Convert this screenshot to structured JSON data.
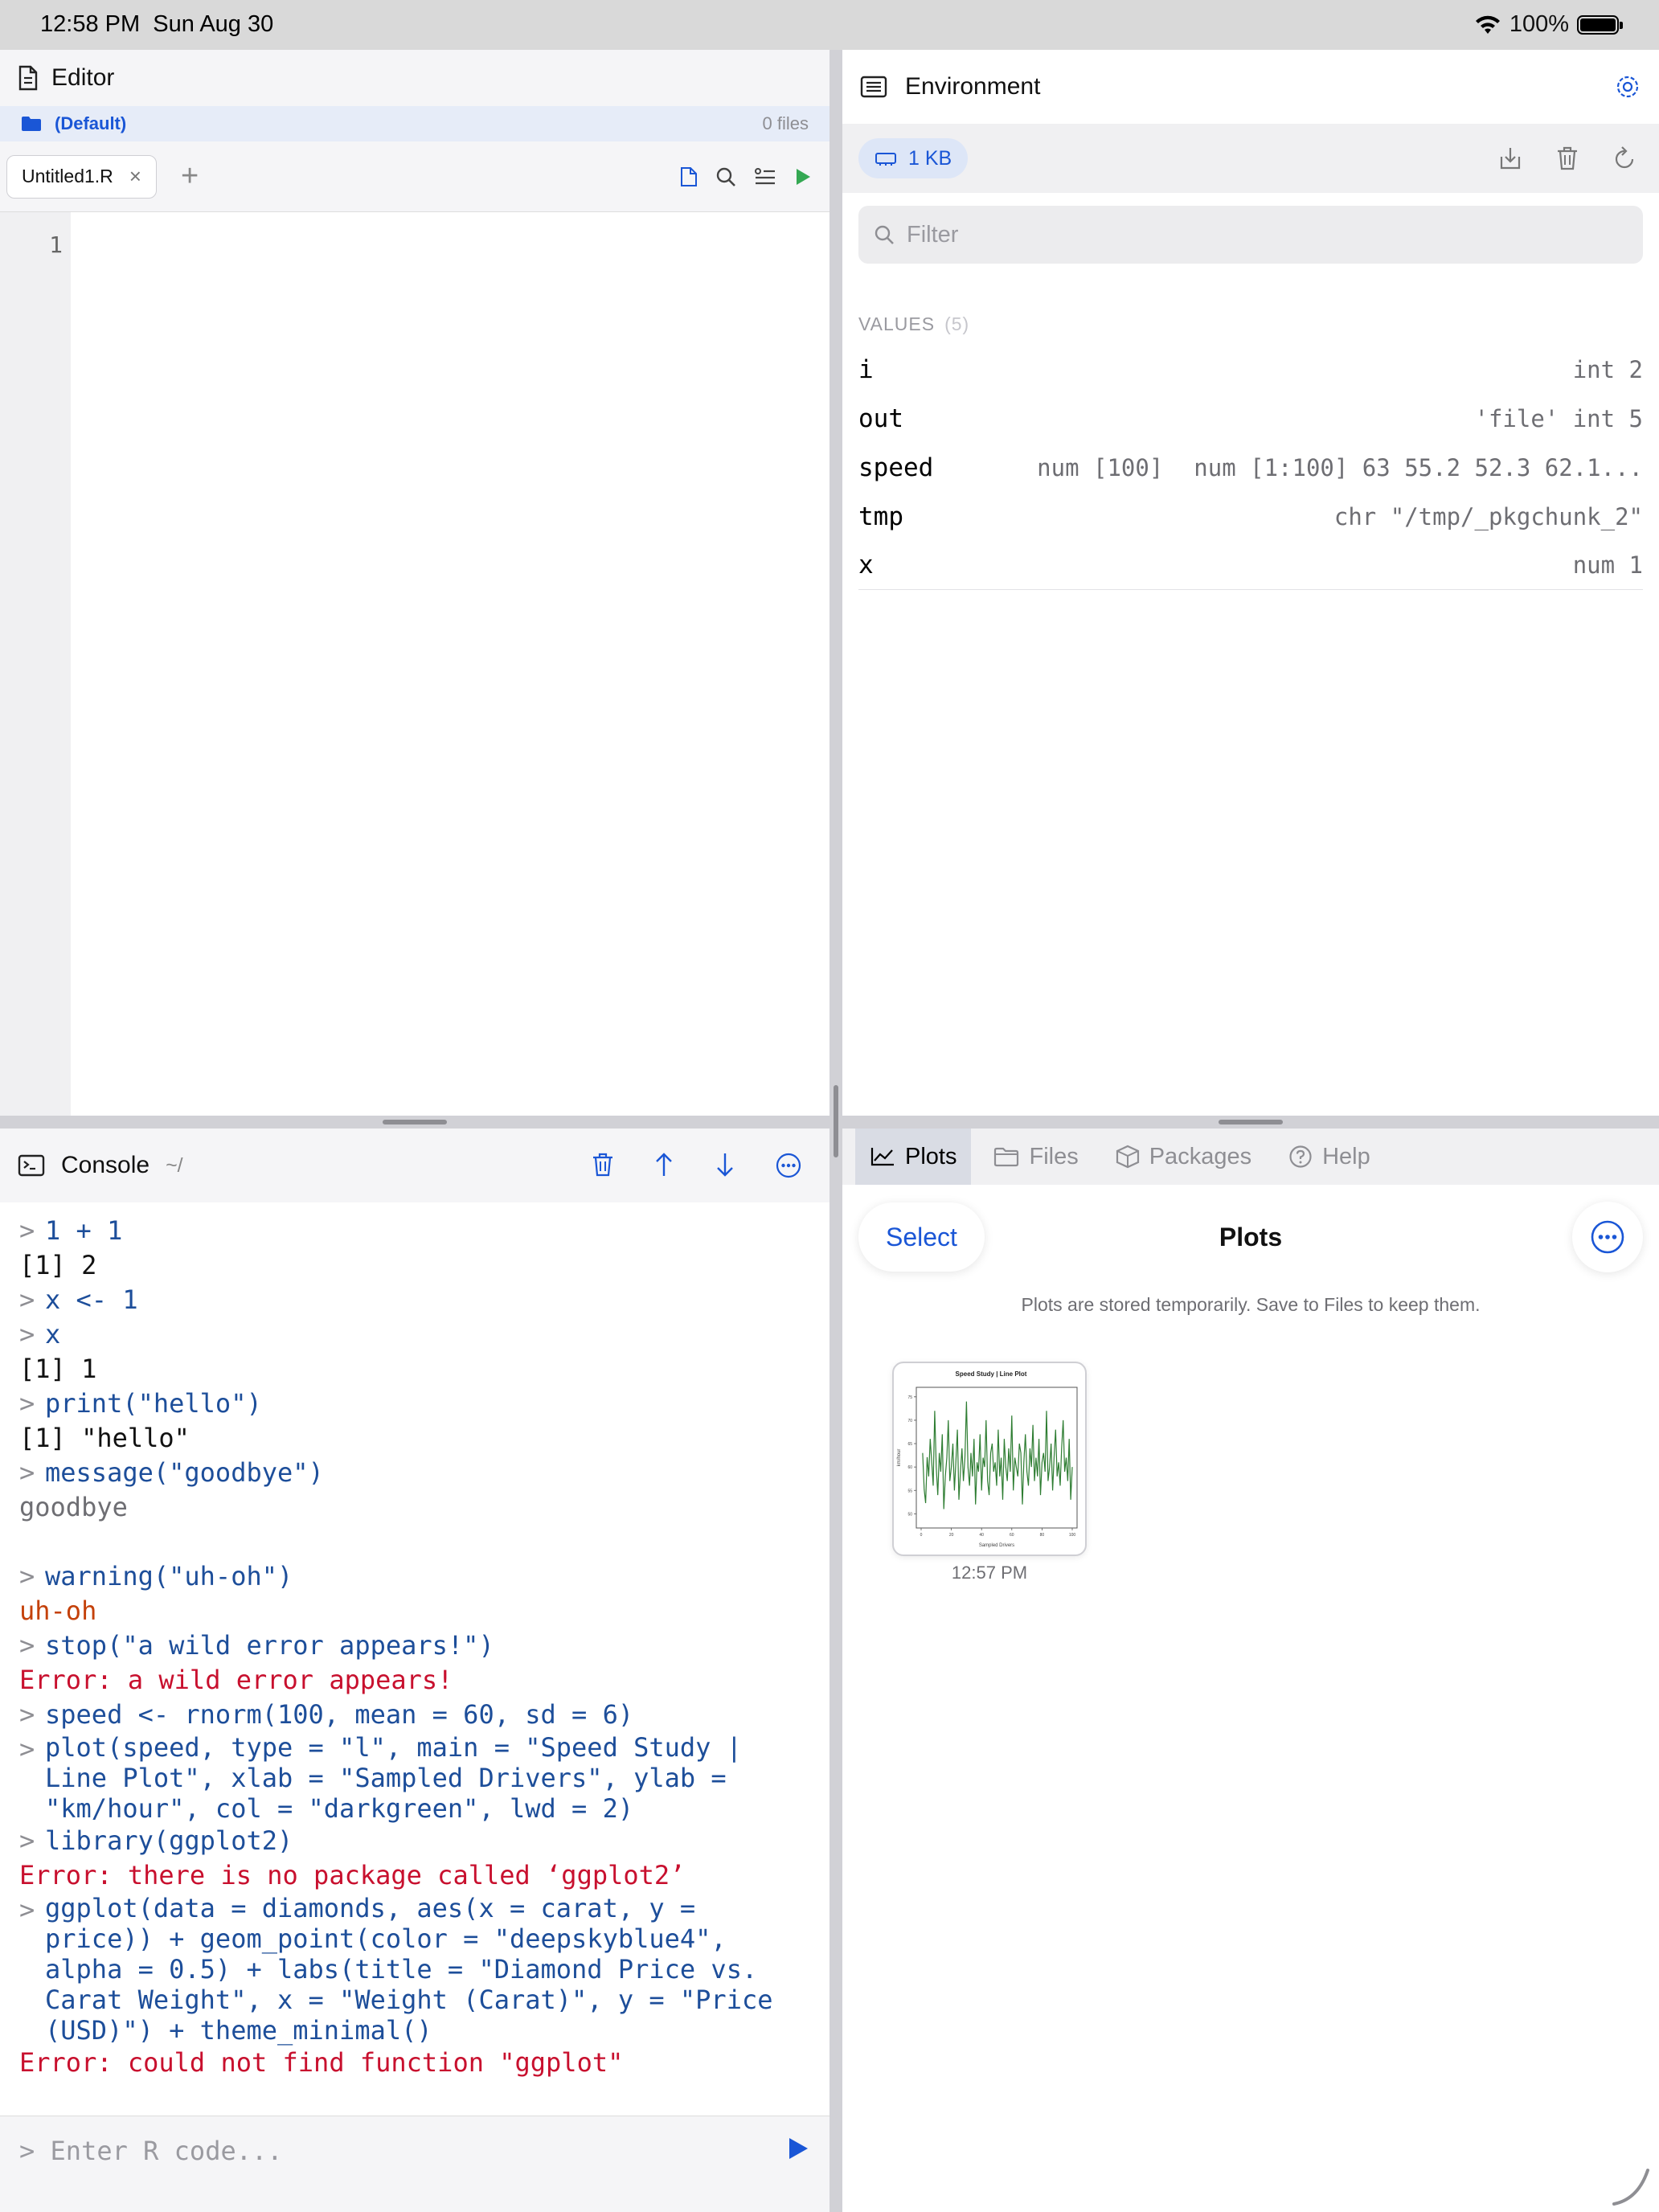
{
  "status_bar": {
    "time": "12:58 PM",
    "date": "Sun Aug 30",
    "battery": "100%"
  },
  "editor": {
    "title": "Editor",
    "project": "(Default)",
    "file_count": "0 files",
    "tabs": [
      {
        "label": "Untitled1.R",
        "close": "×"
      }
    ],
    "add_tab": "+",
    "line_numbers": [
      "1"
    ]
  },
  "environment": {
    "title": "Environment",
    "memory": "1 KB",
    "filter_placeholder": "Filter",
    "section_label": "VALUES",
    "section_count": "(5)",
    "variables": [
      {
        "name": "i",
        "value": "int 2"
      },
      {
        "name": "out",
        "value": "'file' int 5"
      },
      {
        "name": "speed",
        "dims": "num [100]",
        "value": "num [1:100] 63 55.2 52.3 62.1..."
      },
      {
        "name": "tmp",
        "value": "chr \"/tmp/_pkgchunk_2\""
      },
      {
        "name": "x",
        "value": "num 1"
      }
    ]
  },
  "console": {
    "title": "Console",
    "path": "~/",
    "prompt": ">",
    "lines": [
      {
        "type": "cmd",
        "text": "1 + 1"
      },
      {
        "type": "out",
        "text": "[1] 2"
      },
      {
        "type": "cmd",
        "text": "x <- 1"
      },
      {
        "type": "cmd",
        "text": "x"
      },
      {
        "type": "out",
        "text": "[1] 1"
      },
      {
        "type": "cmd",
        "text": "print(\"hello\")"
      },
      {
        "type": "out",
        "text": "[1] \"hello\""
      },
      {
        "type": "cmd",
        "text": "message(\"goodbye\")"
      },
      {
        "type": "msg",
        "text": "goodbye"
      },
      {
        "type": "blank",
        "text": ""
      },
      {
        "type": "cmd",
        "text": "warning(\"uh-oh\")"
      },
      {
        "type": "warn",
        "text": "uh-oh"
      },
      {
        "type": "cmd",
        "text": "stop(\"a wild error appears!\")"
      },
      {
        "type": "err",
        "text": "Error: a wild error appears!"
      },
      {
        "type": "cmd",
        "text": "speed <- rnorm(100, mean = 60, sd = 6)"
      },
      {
        "type": "cmd",
        "text": "plot(speed, type = \"l\", main = \"Speed Study |\nLine Plot\", xlab = \"Sampled Drivers\", ylab =\n\"km/hour\", col = \"darkgreen\", lwd = 2)"
      },
      {
        "type": "cmd",
        "text": "library(ggplot2)"
      },
      {
        "type": "err",
        "text": "Error: there is no package called ‘ggplot2’"
      },
      {
        "type": "cmd",
        "text": "ggplot(data = diamonds, aes(x = carat, y =\nprice)) + geom_point(color = \"deepskyblue4\",\nalpha = 0.5) + labs(title = \"Diamond Price vs.\nCarat Weight\", x = \"Weight (Carat)\", y = \"Price\n(USD)\") + theme_minimal()"
      },
      {
        "type": "err",
        "text": "Error: could not find function \"ggplot\""
      }
    ],
    "input_placeholder": "> Enter R code..."
  },
  "plots_panel": {
    "tabs": [
      {
        "label": "Plots",
        "icon": "chart-line-icon",
        "active": true
      },
      {
        "label": "Files",
        "icon": "folder-icon",
        "active": false
      },
      {
        "label": "Packages",
        "icon": "package-icon",
        "active": false
      },
      {
        "label": "Help",
        "icon": "help-icon",
        "active": false
      }
    ],
    "select_label": "Select",
    "title": "Plots",
    "note": "Plots are stored temporarily. Save to Files to keep them.",
    "plots": [
      {
        "title": "Speed Study | Line Plot",
        "xlabel": "Sampled Drivers",
        "ylabel": "km/hour",
        "time": "12:57 PM"
      }
    ]
  },
  "colors": {
    "accent": "#1a56d6",
    "command": "#1d4e9a",
    "error": "#c8102e",
    "warning": "#c4410a",
    "plot_line": "#2e7d32",
    "run": "#34a853"
  },
  "chart_data": {
    "type": "line",
    "title": "Speed Study | Line Plot",
    "xlabel": "Sampled Drivers",
    "ylabel": "km/hour",
    "x_ticks": [
      "0",
      "20",
      "40",
      "60",
      "80",
      "100"
    ],
    "y_ticks": [
      "50",
      "55",
      "60",
      "65",
      "70",
      "75"
    ],
    "series": [
      {
        "color": "#2e7d32",
        "values": [
          63,
          55.2,
          52.3,
          62.1,
          58,
          66,
          61,
          56,
          72,
          60,
          54,
          63,
          59,
          67,
          51,
          58,
          62,
          70,
          57,
          60,
          65,
          55,
          61,
          68,
          53,
          59,
          64,
          57,
          62,
          74,
          60,
          56,
          63,
          58,
          66,
          52,
          61,
          59,
          67,
          55,
          62,
          60,
          70,
          57,
          54,
          63,
          65,
          59,
          61,
          56,
          68,
          58,
          62,
          53,
          66,
          60,
          57,
          64,
          59,
          71,
          55,
          62,
          60,
          58,
          65,
          63,
          52,
          61,
          67,
          59,
          56,
          64,
          60,
          69,
          57,
          62,
          58,
          66,
          54,
          61,
          63,
          59,
          72,
          57,
          60,
          65,
          55,
          62,
          68,
          58,
          61,
          56,
          64,
          70,
          59,
          62,
          57,
          66,
          53,
          60
        ]
      }
    ],
    "xlim": [
      0,
      100
    ],
    "ylim": [
      48,
      76
    ]
  }
}
